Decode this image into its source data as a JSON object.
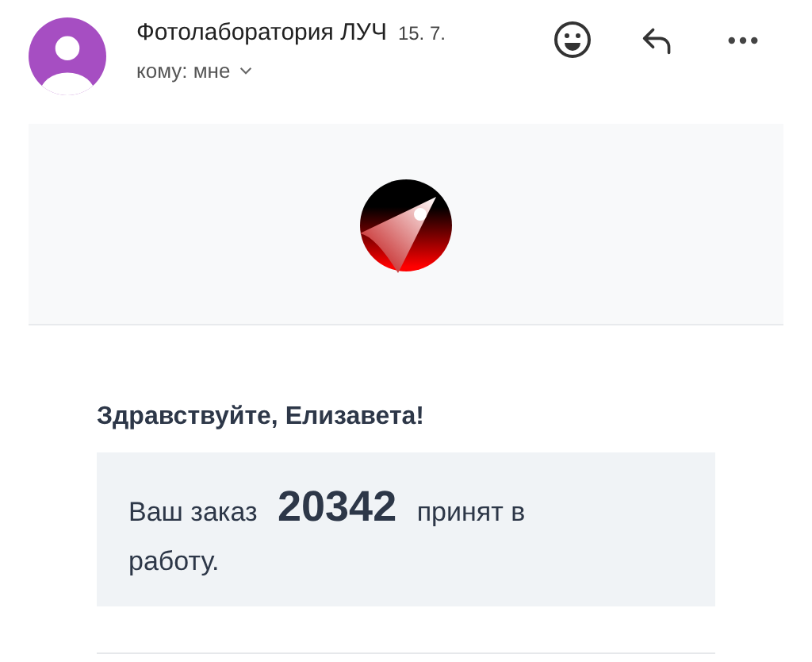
{
  "header": {
    "sender": "Фотолаборатория ЛУЧ",
    "date": "15. 7.",
    "recipient": "кому: мне"
  },
  "email": {
    "greeting": "Здравствуйте, Елизавета!",
    "message": "Ваш заказ **20342** принят в работу."
  }
}
